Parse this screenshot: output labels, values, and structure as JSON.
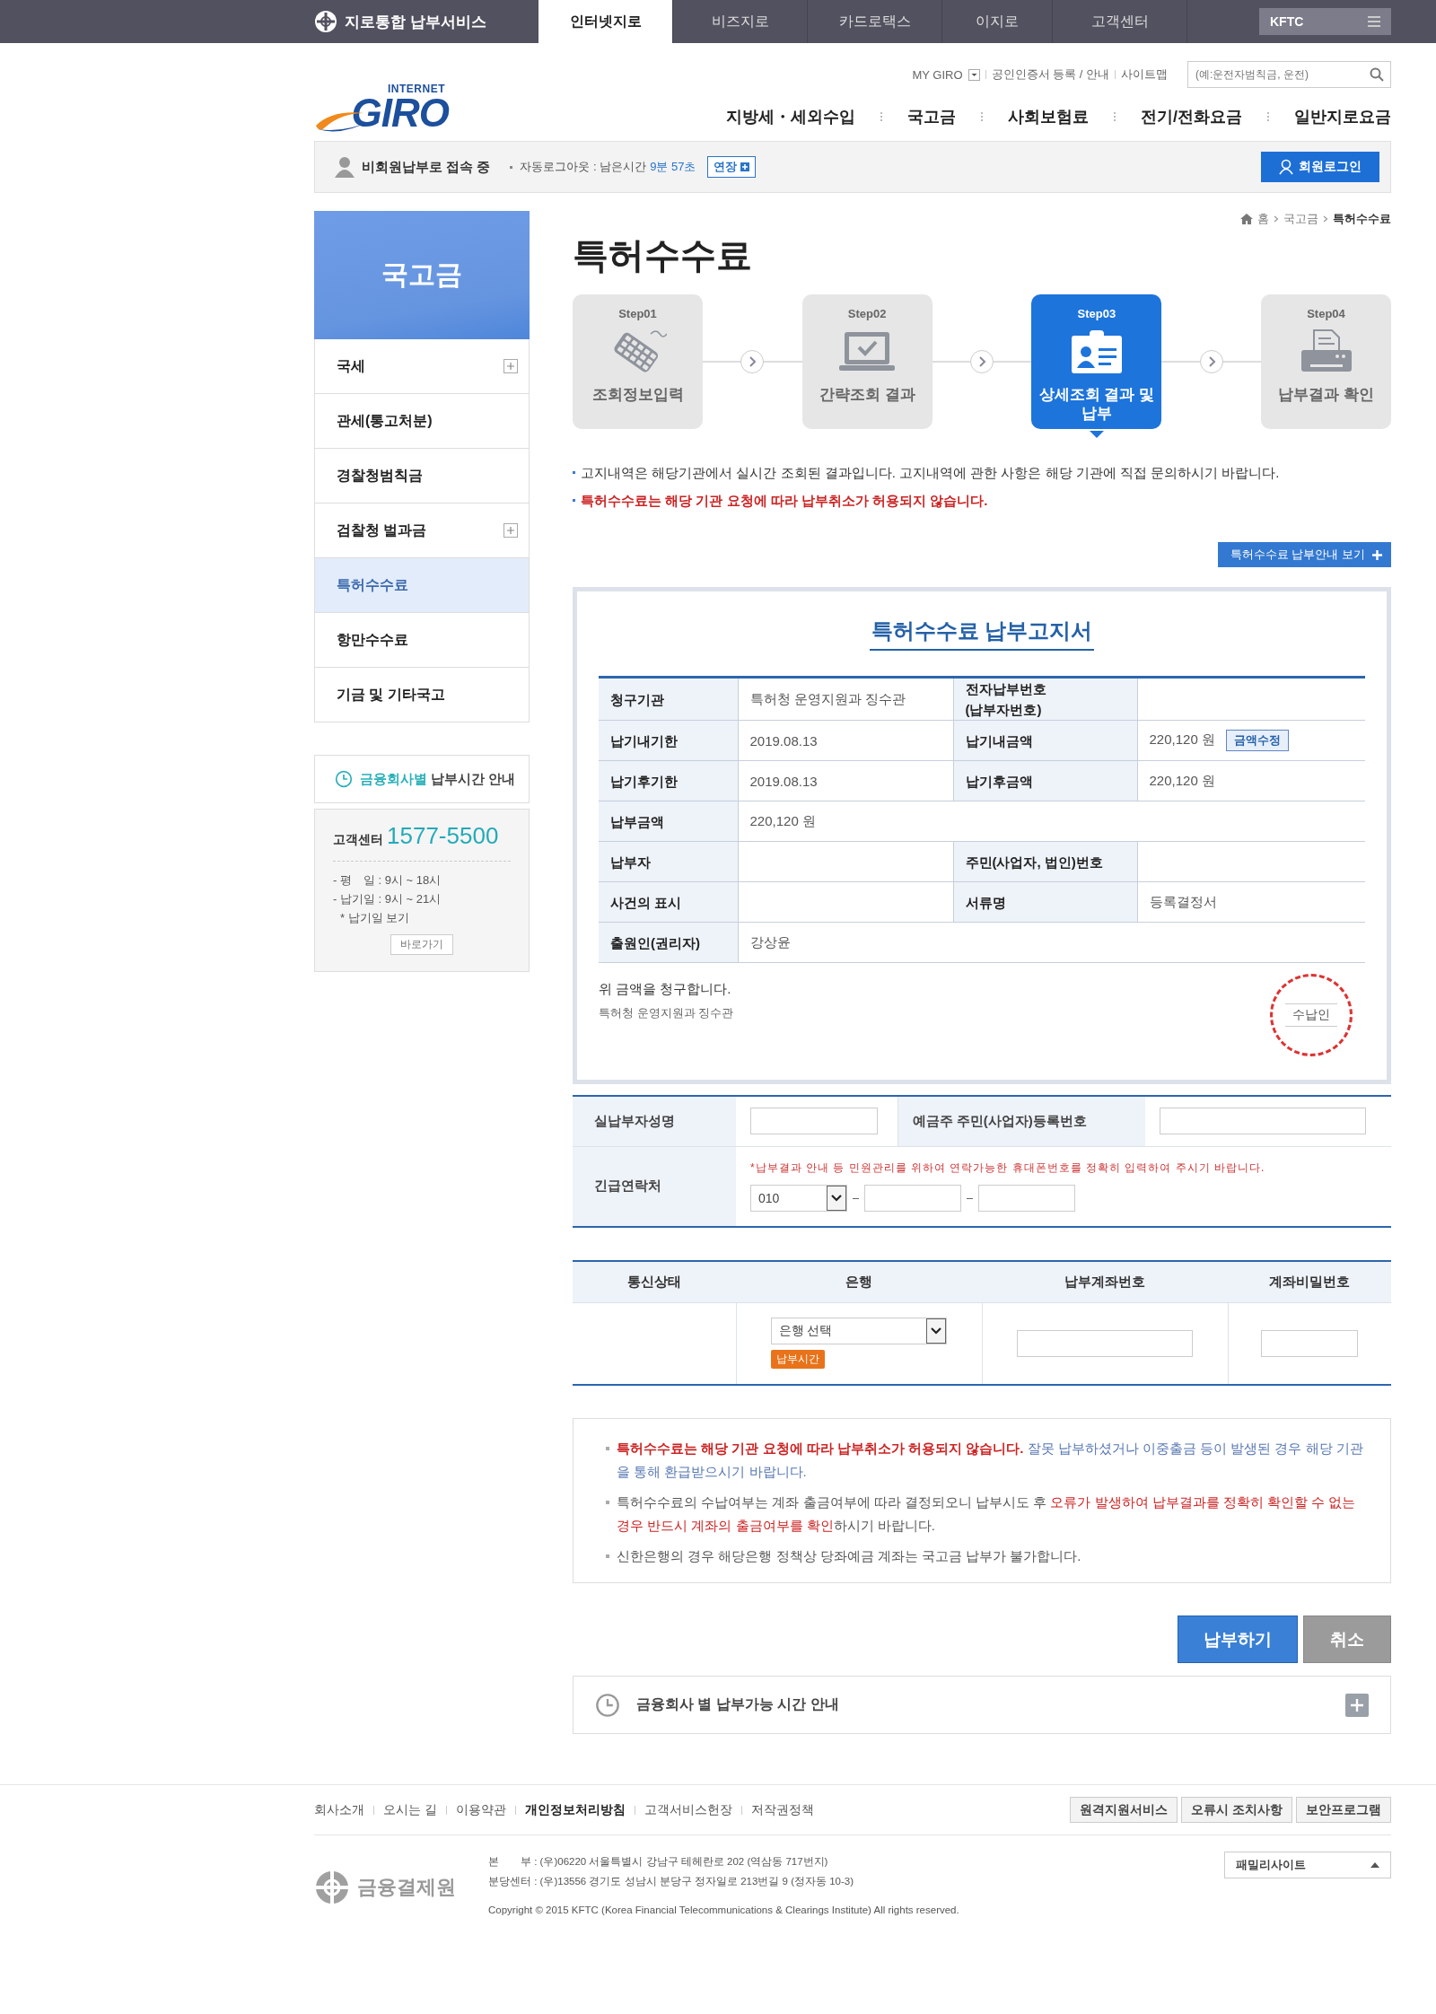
{
  "topbar": {
    "brand": "지로통합 납부서비스",
    "tabs": [
      {
        "label": "인터넷지로",
        "selected": true
      },
      {
        "label": "비즈지로",
        "selected": false
      },
      {
        "label": "카드로택스",
        "selected": false
      },
      {
        "label": "이지로",
        "selected": false
      },
      {
        "label": "고객센터",
        "selected": false
      }
    ],
    "kftc": "KFTC"
  },
  "header": {
    "logo_small": "INTERNET",
    "logo": "GIRO",
    "util_links": [
      "MY GIRO",
      "공인인증서 등록 / 안내",
      "사이트맵"
    ],
    "search": {
      "placeholder": "(예:운전자범칙금, 운전)"
    },
    "nav": [
      "지방세・세외수입",
      "국고금",
      "사회보험료",
      "전기/전화요금",
      "일반지로요금"
    ]
  },
  "status_bar": {
    "user": "비회원납부로 접속 중",
    "autologout": "자동로그아웃 : 남은시간",
    "time": "9분 57초",
    "extend": "연장",
    "login": "회원로그인"
  },
  "sidebar": {
    "title": "국고금",
    "items": [
      {
        "label": "국세",
        "expandable": true,
        "selected": false
      },
      {
        "label": "관세(통고처분)",
        "expandable": false,
        "selected": false
      },
      {
        "label": "경찰청범칙금",
        "expandable": false,
        "selected": false
      },
      {
        "label": "검찰청 벌과금",
        "expandable": true,
        "selected": false
      },
      {
        "label": "특허수수료",
        "expandable": false,
        "selected": true
      },
      {
        "label": "항만수수료",
        "expandable": false,
        "selected": false
      },
      {
        "label": "기금 및 기타국고",
        "expandable": false,
        "selected": false
      }
    ],
    "hours_link": {
      "highlight": "금융회사별",
      "text": "납부시간 안내"
    },
    "support": {
      "label": "고객센터",
      "phone": "1577-5500",
      "hours": [
        "- 평　일 : 9시 ~ 18시",
        "- 납기일 : 9시 ~ 21시"
      ],
      "note": "* 납기일 보기",
      "button": "바로가기"
    }
  },
  "breadcrumb": [
    "홈",
    "국고금",
    "특허수수료"
  ],
  "page_title": "특허수수료",
  "steps": [
    {
      "step": "Step01",
      "label": "조회정보입력",
      "kind": "keyboard",
      "selected": false
    },
    {
      "step": "Step02",
      "label": "간략조회 결과",
      "kind": "laptop",
      "selected": false
    },
    {
      "step": "Step03",
      "label": "상세조회 결과 및 납부",
      "kind": "card",
      "selected": true
    },
    {
      "step": "Step04",
      "label": "납부결과 확인",
      "kind": "printer",
      "selected": false
    }
  ],
  "notices": [
    {
      "text": "고지내역은 해당기관에서 실시간 조회된 결과입니다. 고지내역에 관한 사항은 해당 기관에 직접 문의하시기 바랍니다.",
      "kind": "normal"
    },
    {
      "text": "특허수수료는 해당 기관 요청에 따라 납부취소가 허용되지 않습니다.",
      "kind": "warning"
    }
  ],
  "guide_button": "특허수수료 납부안내 보기",
  "bill": {
    "title": "특허수수료 납부고지서",
    "rows": [
      [
        {
          "label": "청구기관",
          "value": "특허청 운영지원과 징수관"
        },
        {
          "label": "전자납부번호\n(납부자번호)"
        }
      ],
      [
        {
          "label": "납기내기한",
          "value": "2019.08.13"
        },
        {
          "label": "납기내금액",
          "value": "220,120 원",
          "button": "금액수정"
        }
      ],
      [
        {
          "label": "납기후기한",
          "value": "2019.08.13"
        },
        {
          "label": "납기후금액",
          "value": "220,120 원"
        }
      ],
      [
        {
          "label": "납부금액",
          "value": "220,120 원"
        }
      ],
      [
        {
          "label": "납부자"
        },
        {
          "label": "주민(사업자, 법인)번호"
        }
      ],
      [
        {
          "label": "사건의 표시"
        },
        {
          "label": "서류명",
          "value": "등록결정서"
        }
      ],
      [
        {
          "label": "출원인(권리자)",
          "value": "강상윤"
        }
      ]
    ],
    "claim": "위 금액을 청구합니다.",
    "issuer": "특허청 운영지원과 징수관",
    "stamp": "수납인"
  },
  "payer_form": {
    "name_label": "실납부자성명",
    "id_label": "예금주 주민(사업자)등록번호",
    "contact_label": "긴급연락처",
    "contact_hint": "*납부결과 안내 등 민원관리를 위하여 연락가능한 휴대폰번호를 정확히 입력하여 주시기 바랍니다.",
    "phone_prefix": "010"
  },
  "bank_table": {
    "columns": [
      "통신상태",
      "은행",
      "납부계좌번호",
      "계좌비밀번호"
    ],
    "bank_select": "은행 선택",
    "hours_badge": "납부시간"
  },
  "notes": [
    [
      {
        "text": "특허수수료는 해당 기관 요청에 따라 납부취소가 허용되지 않습니다.",
        "kind": "warn"
      },
      {
        "text": " 잘못 납부하셨거나 이중출금 등이 발생된 경우 해당 기관을 통해 환급받으시기 바랍니다.",
        "kind": "info"
      }
    ],
    [
      {
        "text": "특허수수료의 수납여부는 계좌 출금여부에 따라 결정되오니 납부시도 후 ",
        "kind": "plain"
      },
      {
        "text": "오류가 발생하여 납부결과를 정확히 확인할 수 없는 경우 반드시 계좌의 출금여부를 확인",
        "kind": "alert"
      },
      {
        "text": "하시기 바랍니다.",
        "kind": "plain"
      }
    ],
    [
      {
        "text": "신한은행의 경우 해당은행 정책상 당좌예금 계좌는 국고금 납부가 불가합니다.",
        "kind": "plain"
      }
    ]
  ],
  "actions": {
    "submit": "납부하기",
    "cancel": "취소"
  },
  "accordion": {
    "label": "금융회사 별 납부가능 시간 안내",
    "expanded": false
  },
  "footer": {
    "links": [
      {
        "label": "회사소개",
        "bold": false
      },
      {
        "label": "오시는 길",
        "bold": false
      },
      {
        "label": "이용약관",
        "bold": false
      },
      {
        "label": "개인정보처리방침",
        "bold": true
      },
      {
        "label": "고객서비스헌장",
        "bold": false
      },
      {
        "label": "저작권정책",
        "bold": false
      }
    ],
    "buttons": [
      "원격지원서비스",
      "오류시 조치사항",
      "보안프로그램"
    ],
    "org": "금융결제원",
    "address": [
      "본　　부 : (우)06220 서울특별시 강남구 테헤란로 202 (역삼동 717번지)",
      "분당센터 : (우)13556 경기도 성남시 분당구 정자일로 213번길 9 (정자동 10-3)"
    ],
    "copyright": "Copyright © 2015 KFTC (Korea Financial Telecommunications & Clearings Institute) All rights reserved.",
    "family_site": "패밀리사이트"
  }
}
